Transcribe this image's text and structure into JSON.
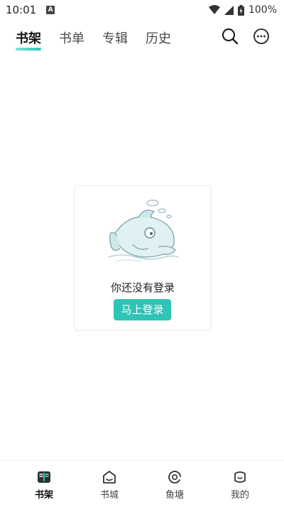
{
  "status_bar": {
    "time": "10:01",
    "notification_badge": "A",
    "battery": "100%"
  },
  "top_tabs": {
    "tabs": [
      {
        "label": "书架",
        "active": true
      },
      {
        "label": "书单",
        "active": false
      },
      {
        "label": "专辑",
        "active": false
      },
      {
        "label": "历史",
        "active": false
      }
    ],
    "icons": [
      "search-icon",
      "more-icon"
    ]
  },
  "empty_state": {
    "message": "你还没有登录",
    "login_button": "马上登录"
  },
  "bottom_nav": {
    "items": [
      {
        "label": "书架",
        "icon": "bookshelf-icon",
        "active": true
      },
      {
        "label": "书城",
        "icon": "bookstore-icon",
        "active": false
      },
      {
        "label": "鱼塘",
        "icon": "fishpond-icon",
        "active": false
      },
      {
        "label": "我的",
        "icon": "profile-icon",
        "active": false
      }
    ]
  },
  "colors": {
    "accent": "#2ec4b6",
    "text_primary": "#111111",
    "text_secondary": "#4a4a4a"
  }
}
